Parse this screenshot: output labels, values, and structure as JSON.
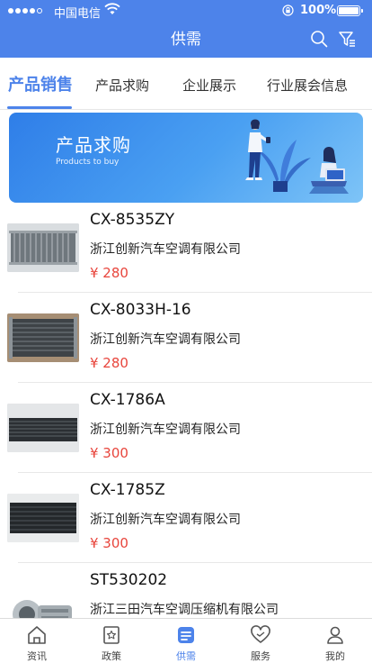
{
  "status_bar": {
    "carrier": "中国电信",
    "battery": "100%"
  },
  "nav": {
    "title": "供需"
  },
  "tabs": [
    {
      "label": "产品销售",
      "active": true
    },
    {
      "label": "产品求购",
      "active": false
    },
    {
      "label": "企业展示",
      "active": false
    },
    {
      "label": "行业展会信息",
      "active": false
    }
  ],
  "banner": {
    "title": "产品求购",
    "subtitle": "Products to buy"
  },
  "products": [
    {
      "model": "CX-8535ZY",
      "company": "浙江创新汽车空调有限公司",
      "price": "¥ 280"
    },
    {
      "model": "CX-8033H-16",
      "company": "浙江创新汽车空调有限公司",
      "price": "¥ 280"
    },
    {
      "model": "CX-1786A",
      "company": "浙江创新汽车空调有限公司",
      "price": "¥ 300"
    },
    {
      "model": "CX-1785Z",
      "company": "浙江创新汽车空调有限公司",
      "price": "¥ 300"
    },
    {
      "model": "ST530202",
      "company": "浙江三田汽车空调压缩机有限公司",
      "price": ""
    }
  ],
  "tabbar": [
    {
      "label": "资讯",
      "icon": "home-icon"
    },
    {
      "label": "政策",
      "icon": "policy-icon"
    },
    {
      "label": "供需",
      "icon": "supply-demand-icon",
      "active": true
    },
    {
      "label": "服务",
      "icon": "heart-icon"
    },
    {
      "label": "我的",
      "icon": "user-icon"
    }
  ],
  "colors": {
    "accent": "#4d83ea",
    "price": "#e8453c"
  }
}
